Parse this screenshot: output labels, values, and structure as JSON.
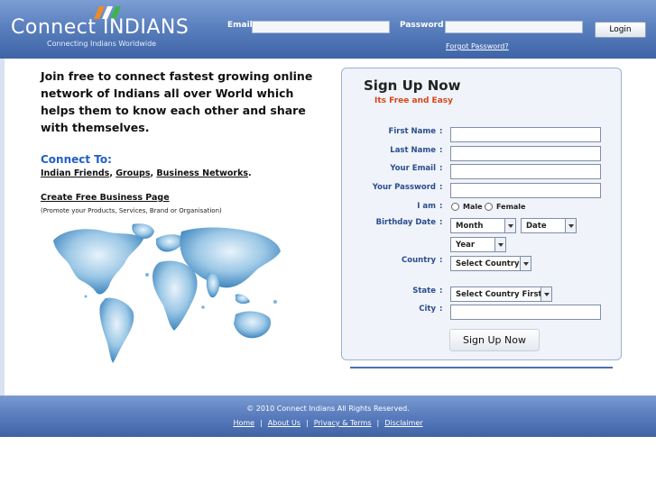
{
  "header": {
    "logo_text": "Connect INDIANS",
    "tagline": "Connecting Indians Worldwide",
    "email_label": "Email",
    "password_label": "Password",
    "email_value": "",
    "password_value": "",
    "login_label": "Login",
    "forgot_label": "Forgot Password?"
  },
  "intro": {
    "text": "Join free to connect fastest growing online network of Indians all over World which helps them to know each other and share with themselves.",
    "connect_heading": "Connect To:",
    "connect_links": [
      "Indian Friends",
      "Groups",
      "Business Networks"
    ],
    "create_page": "Create Free Business Page",
    "create_note": "(Promote your Products, Services, Brand or Organisation)"
  },
  "signup": {
    "title": "Sign Up Now",
    "subtitle": "Its Free and Easy",
    "fields": {
      "first_name": "First Name",
      "last_name": "Last Name",
      "email": "Your Email",
      "password": "Your Password",
      "iam": "I am",
      "birthday": "Birthday Date",
      "country": "Country",
      "state": "State",
      "city": "City"
    },
    "colon": ":",
    "gender_male": "Male",
    "gender_female": "Female",
    "month_selected": "Month",
    "date_selected": "Date",
    "year_selected": "Year",
    "country_selected": "Select Country",
    "state_selected": "Select Country First",
    "button": "Sign Up Now"
  },
  "footer": {
    "copyright": "© 2010   Connect Indians   All Rights Reserved.",
    "links": [
      "Home",
      "About Us",
      "Privacy & Terms",
      "Disclaimer"
    ],
    "separator": "|"
  },
  "colors": {
    "header_blue": "#5b80bf",
    "accent_blue": "#1f5fc7",
    "label_blue": "#2a4d8f",
    "subtitle_orange": "#d8461b"
  }
}
